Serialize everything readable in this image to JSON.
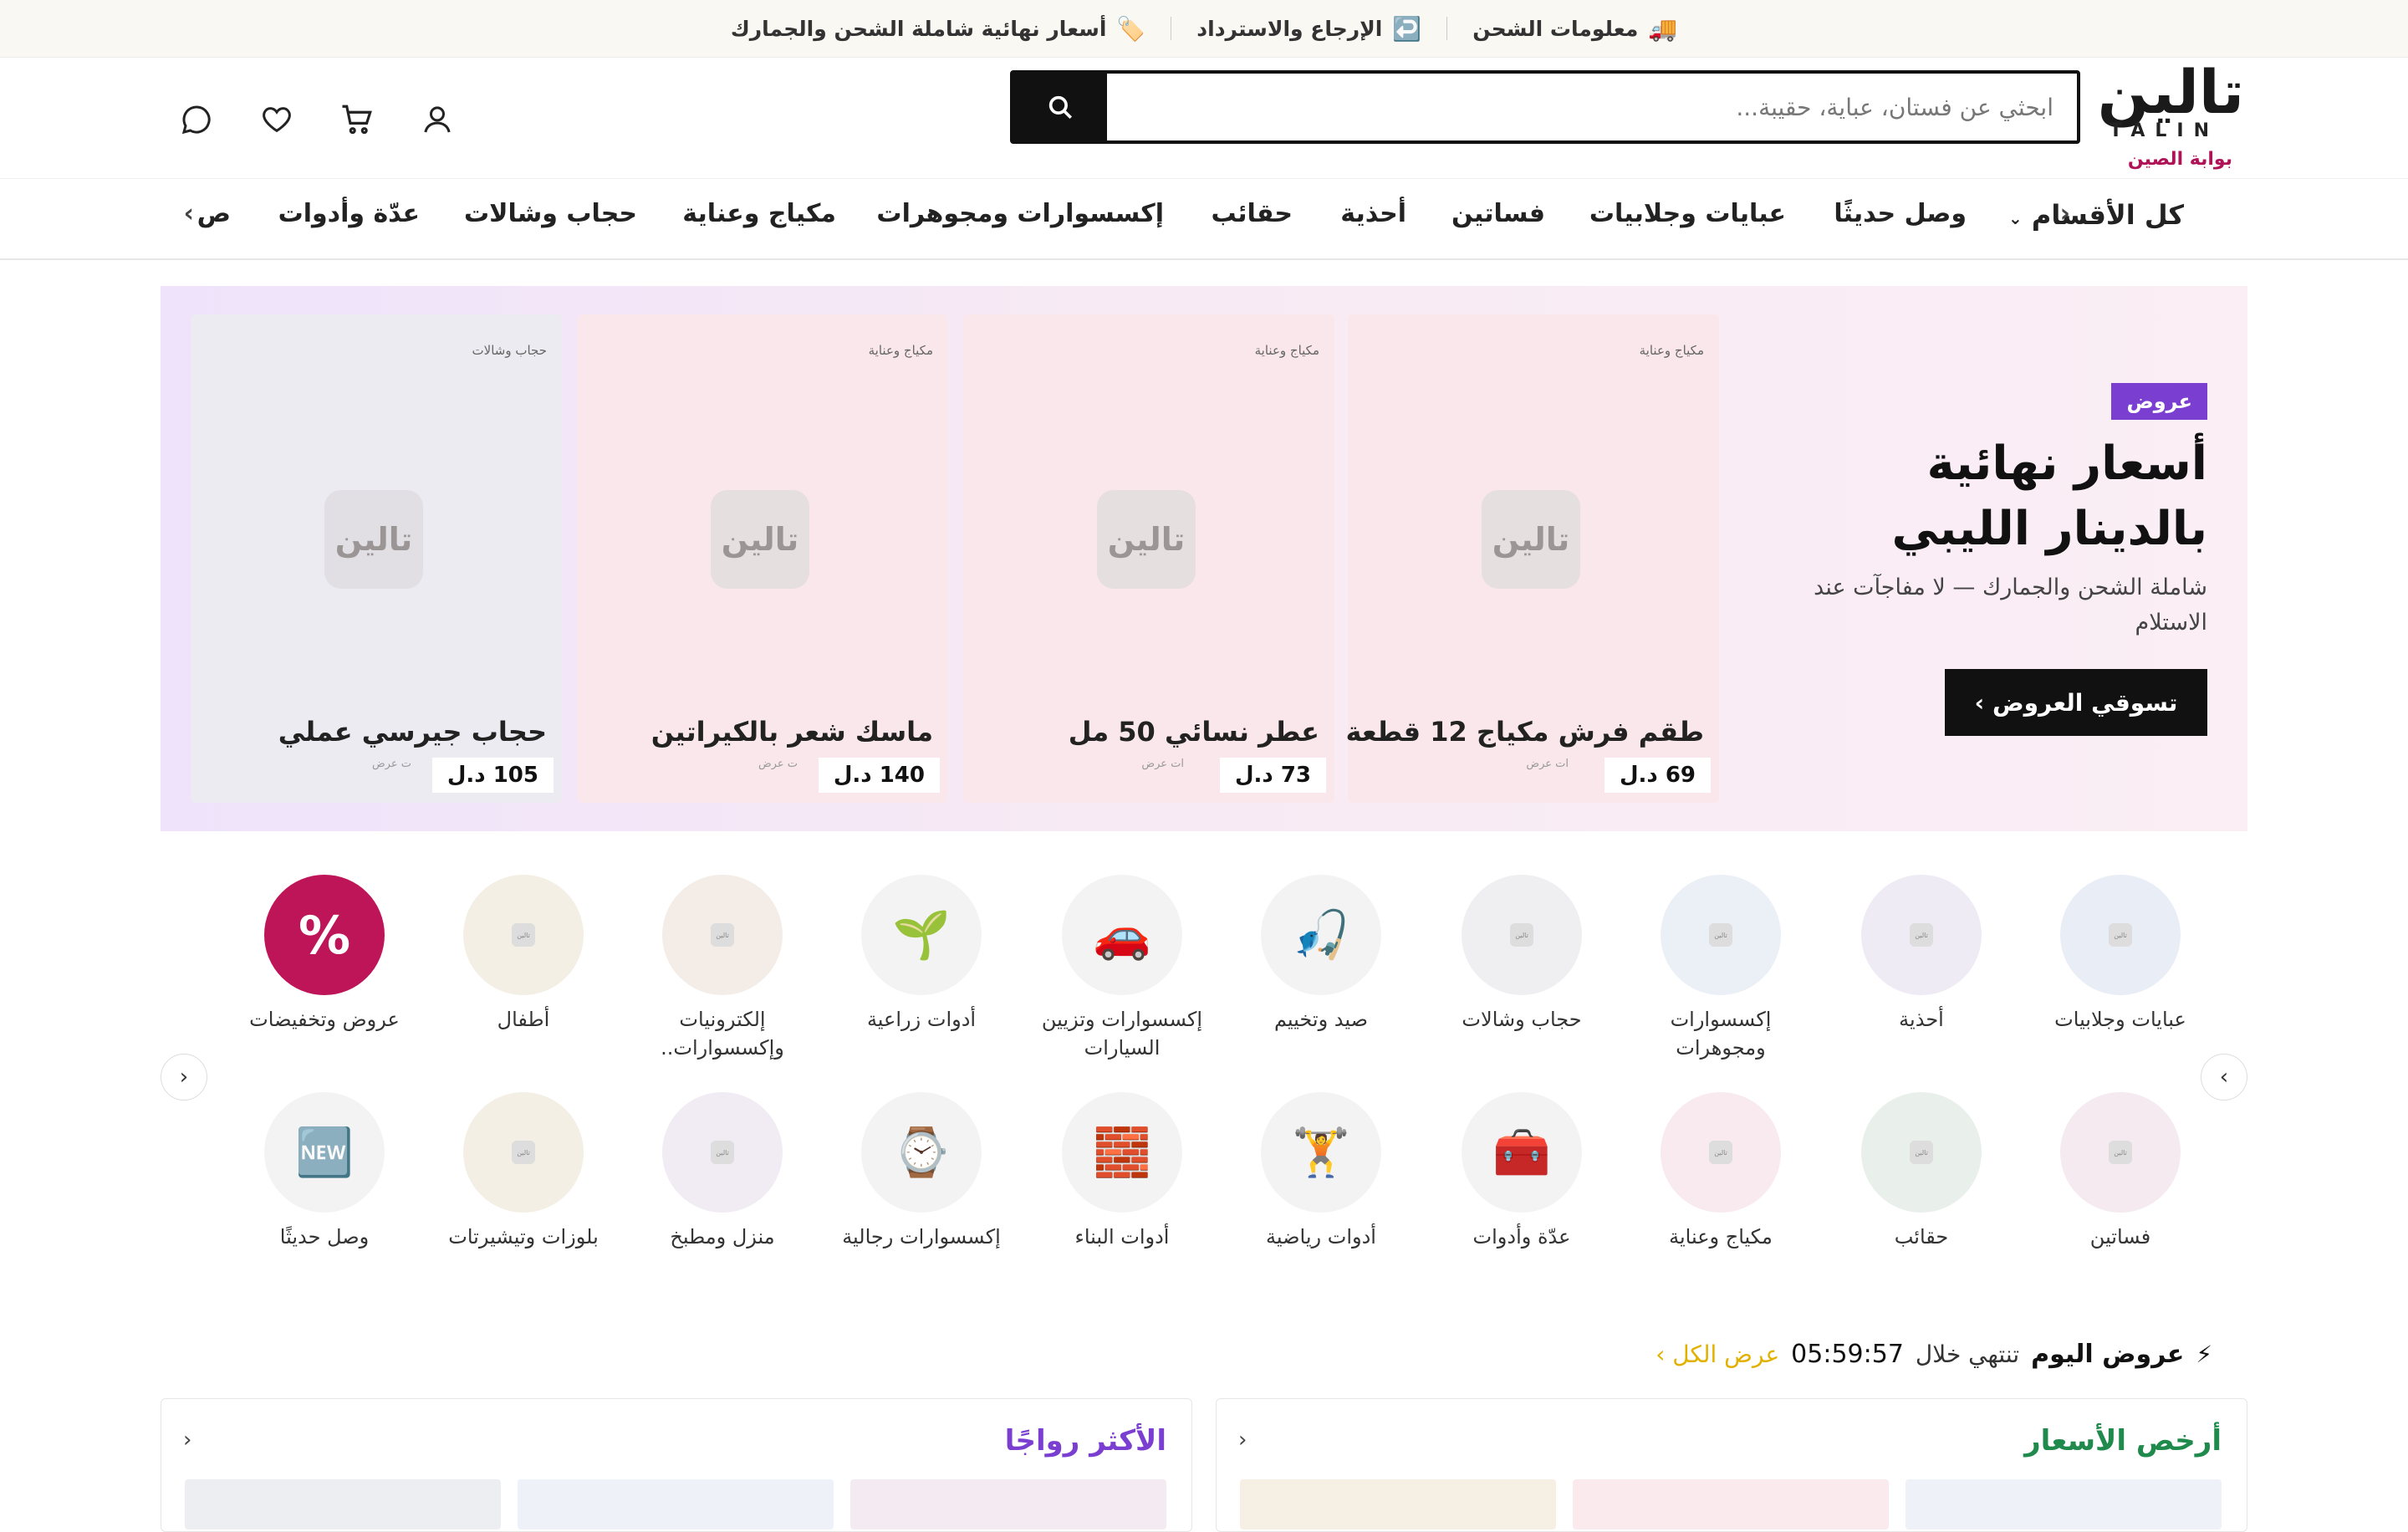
{
  "topbar": {
    "items": [
      {
        "icon": "truck",
        "label": "معلومات الشحن"
      },
      {
        "icon": "return-arrow",
        "label": "الإرجاع والاسترداد"
      },
      {
        "icon": "tag",
        "label": "أسعار نهائية شاملة الشحن والجمارك"
      }
    ]
  },
  "header": {
    "logo_ar": "تالين",
    "logo_en": "TALIN",
    "logo_sub": "بوابة الصين",
    "search_placeholder": "ابحثي عن فستان، عباية، حقيبة...",
    "icons": [
      "user-icon",
      "cart-icon",
      "heart-icon",
      "chat-icon"
    ]
  },
  "nav": {
    "all_label": "كل الأقسام",
    "items": [
      "وصل حديثًا",
      "عبايات وجلابيات",
      "فساتين",
      "أحذية",
      "حقائب",
      "إكسسوارات ومجوهرات",
      "مكياج وعناية",
      "حجاب وشالات",
      "عدّة وأدوات",
      "ص"
    ]
  },
  "hero": {
    "badge": "عروض",
    "title_line1": "أسعار نهائية",
    "title_line2": "بالدينار الليبي",
    "subtitle": "شاملة الشحن والجمارك — لا مفاجآت عند الاستلام",
    "cta": "تسوقي العروض ›",
    "placeholder_text": "تالين",
    "products": [
      {
        "category": "مكياج وعناية",
        "name": "طقم فرش مكياج 12 قطعة",
        "price": "69 د.ل",
        "note": "ات عرض"
      },
      {
        "category": "مكياج وعناية",
        "name": "عطر نسائي 50 مل",
        "price": "73 د.ل",
        "note": "ات عرض"
      },
      {
        "category": "مكياج وعناية",
        "name": "ماسك شعر بالكيراتين",
        "price": "140 د.ل",
        "note": "ت عرض"
      },
      {
        "category": "حجاب وشالات",
        "name": "حجاب جيرسي عملي",
        "price": "105 د.ل",
        "note": "ت عرض"
      }
    ]
  },
  "categories": {
    "row1": [
      {
        "label": "عبايات وجلابيات",
        "icon": "placeholder"
      },
      {
        "label": "أحذية",
        "icon": "placeholder"
      },
      {
        "label": "إكسسوارات ومجوهرات",
        "icon": "placeholder"
      },
      {
        "label": "حجاب وشالات",
        "icon": "placeholder"
      },
      {
        "label": "صيد وتخييم",
        "icon": "🎣"
      },
      {
        "label": "إكسسوارات وتزيين السيارات",
        "icon": "🚗"
      },
      {
        "label": "أدوات زراعية",
        "icon": "🌱"
      },
      {
        "label": "إلكترونيات وإكسسوارات..",
        "icon": "placeholder"
      },
      {
        "label": "أطفال",
        "icon": "placeholder"
      },
      {
        "label": "عروض وتخفيضات",
        "icon": "%"
      }
    ],
    "row2": [
      {
        "label": "فساتين",
        "icon": "placeholder"
      },
      {
        "label": "حقائب",
        "icon": "placeholder"
      },
      {
        "label": "مكياج وعناية",
        "icon": "placeholder"
      },
      {
        "label": "عدّة وأدوات",
        "icon": "🧰"
      },
      {
        "label": "أدوات رياضية",
        "icon": "🏋"
      },
      {
        "label": "أدوات البناء",
        "icon": "🧱"
      },
      {
        "label": "إكسسوارات رجالية",
        "icon": "⌚"
      },
      {
        "label": "منزل ومطبخ",
        "icon": "placeholder"
      },
      {
        "label": "بلوزات وتيشيرتات",
        "icon": "placeholder"
      },
      {
        "label": "وصل حديثًا",
        "icon": "🆕"
      }
    ]
  },
  "deals": {
    "title": "عروض اليوم",
    "ends_in": "تنتهي خلال",
    "timer": "05:59:57",
    "view_all": "عرض الكل ›"
  },
  "panels": {
    "cheapest": "أرخص الأسعار",
    "trending": "الأكثر رواجًا"
  },
  "colors": {
    "accent_purple": "#7a3fd0",
    "brand_magenta": "#b01257",
    "cheapest_green": "#1f8a4c",
    "deal_yellow": "#e2b100"
  }
}
